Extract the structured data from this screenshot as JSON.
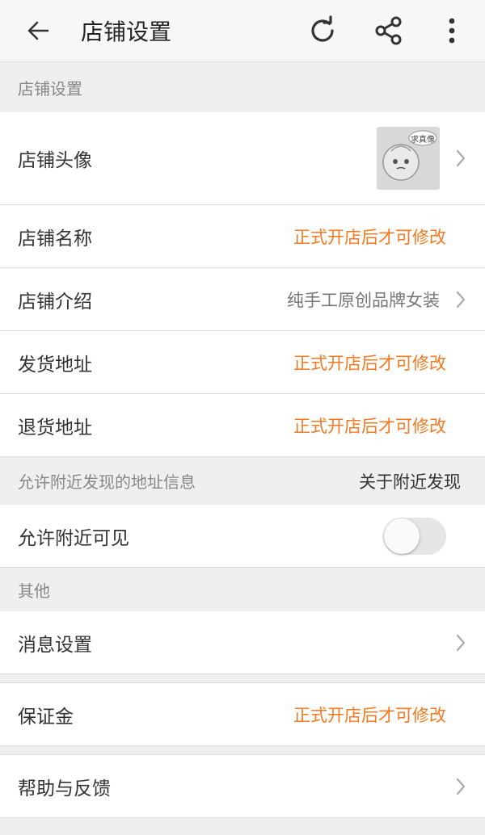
{
  "header": {
    "title": "店铺设置",
    "icons": [
      "back-arrow-icon",
      "refresh-icon",
      "share-icon",
      "more-vertical-icon"
    ]
  },
  "sections": {
    "store": {
      "header": "店铺设置",
      "avatar": {
        "label": "店铺头像",
        "badge": "求真像"
      },
      "name": {
        "label": "店铺名称",
        "value": "正式开店后才可修改"
      },
      "intro": {
        "label": "店铺介绍",
        "value": "纯手工原创品牌女装"
      },
      "ship_address": {
        "label": "发货地址",
        "value": "正式开店后才可修改"
      },
      "return_address": {
        "label": "退货地址",
        "value": "正式开店后才可修改"
      }
    },
    "nearby": {
      "header": "允许附近发现的地址信息",
      "link": "关于附近发现",
      "visible": {
        "label": "允许附近可见",
        "enabled": false
      }
    },
    "other": {
      "header": "其他",
      "messages": {
        "label": "消息设置"
      },
      "deposit": {
        "label": "保证金",
        "value": "正式开店后才可修改"
      },
      "help": {
        "label": "帮助与反馈"
      }
    }
  },
  "colors": {
    "accent": "#f47920",
    "background": "#efefef",
    "row": "#ffffff",
    "secondary_text": "#888888"
  }
}
